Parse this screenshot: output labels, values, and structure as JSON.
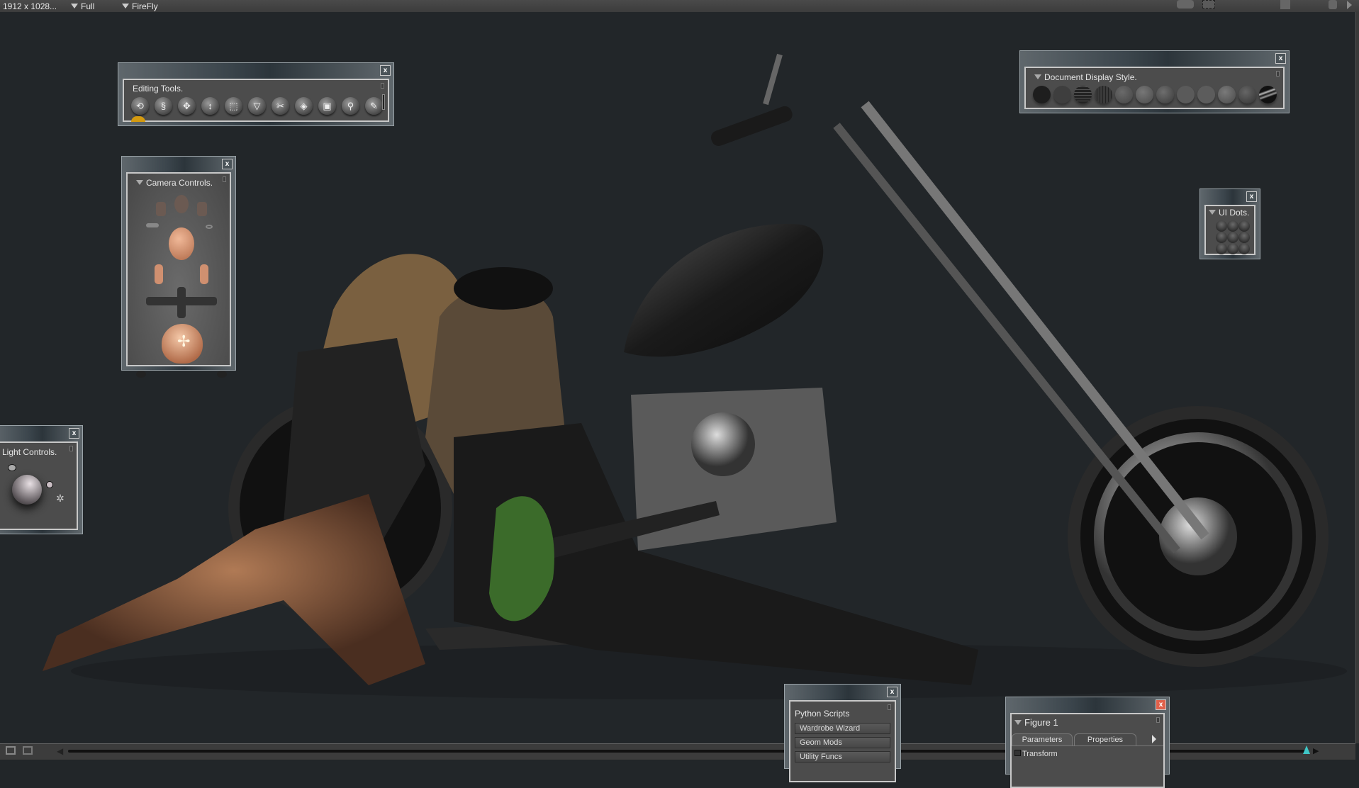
{
  "topbar": {
    "resolution": "1912 x 1028...",
    "mode": "Full",
    "renderer": "FireFly"
  },
  "editing_tools": {
    "title": "Editing Tools.",
    "close": "x",
    "tools": [
      {
        "icon": "rotate-icon",
        "glyph": "⟲"
      },
      {
        "icon": "twist-icon",
        "glyph": "§"
      },
      {
        "icon": "translate-icon",
        "glyph": "✥"
      },
      {
        "icon": "translate-in-out-icon",
        "glyph": "↕"
      },
      {
        "icon": "scale-icon",
        "glyph": "⬚"
      },
      {
        "icon": "taper-icon",
        "glyph": "▽"
      },
      {
        "icon": "chain-break-icon",
        "glyph": "✂"
      },
      {
        "icon": "color-icon",
        "glyph": "◈"
      },
      {
        "icon": "grouping-icon",
        "glyph": "▣"
      },
      {
        "icon": "view-magnifier-icon",
        "glyph": "⚲"
      },
      {
        "icon": "morph-brush-icon",
        "glyph": "✎"
      }
    ]
  },
  "camera_controls": {
    "title": "Camera Controls.",
    "close": "x"
  },
  "light_controls": {
    "title": "Light Controls.",
    "close": "x"
  },
  "display_style": {
    "title": "Document Display Style.",
    "close": "x",
    "styles": [
      "silhouette",
      "outline",
      "wireframe",
      "hidden-line",
      "lit-wireframe",
      "flat-shaded",
      "flat-lined",
      "cartoon",
      "cartoon-with-line",
      "smooth-shaded",
      "smooth-lined",
      "texture-shaded"
    ]
  },
  "ui_dots": {
    "title": "UI Dots.",
    "close": "x",
    "count": 9
  },
  "python_scripts": {
    "title": "Python Scripts",
    "close": "x",
    "buttons": [
      "Wardrobe Wizard",
      "Geom Mods",
      "Utility Funcs"
    ]
  },
  "figure_panel": {
    "title": "Figure 1",
    "close": "x",
    "tabs": [
      "Parameters",
      "Properties"
    ],
    "section": "Transform"
  },
  "colors": {
    "background": "#222629",
    "panel": "#4c4c4c",
    "accent_close": "#e0604a",
    "timeline_marker": "#3fc6c6"
  }
}
